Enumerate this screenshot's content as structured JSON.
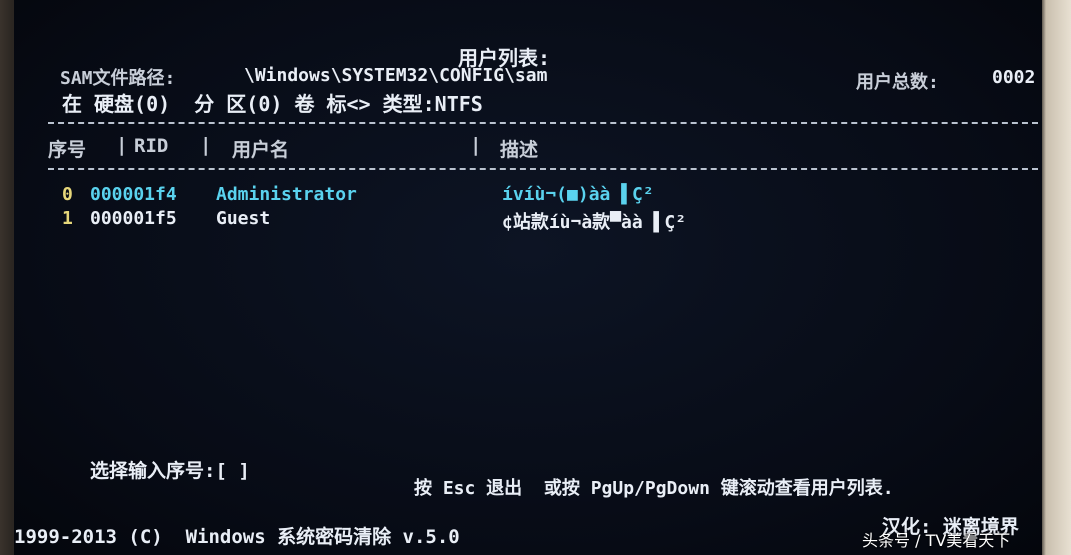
{
  "header": {
    "title": "用户列表:",
    "sam_label": "SAM文件路径:",
    "sam_path": "\\Windows\\SYSTEM32\\CONFIG\\sam",
    "user_count_label": "用户总数:",
    "user_count_value": "0002",
    "disk_info": "在 硬盘(0)  分 区(0) 卷 标<> 类型:NTFS"
  },
  "table": {
    "columns": [
      "序号",
      "RID",
      "用户名",
      "描述"
    ],
    "rows": [
      {
        "index": "0",
        "rid": "000001f4",
        "username": "Administrator",
        "description": "ívíù¬(■)àà ▌Ç²"
      },
      {
        "index": "1",
        "rid": "000001f5",
        "username": "Guest",
        "description": "¢站款íù¬à款▀àà ▌Ç²"
      }
    ]
  },
  "footer": {
    "prompt_label": "选择输入序号:[ ]",
    "help_text": "按 Esc 退出  或按 PgUp/PgDown 键滚动查看用户列表.",
    "copyright": "1999-2013 (C)  Windows 系统密码清除 v.5.0",
    "credit": "汉化: 迷离境界",
    "watermark": "头条号 / TV美看天下"
  },
  "colors": {
    "background": "#070b15",
    "text": "#e9eef6",
    "index_color": "#e6d77a",
    "highlight": "#5ad2ee"
  }
}
